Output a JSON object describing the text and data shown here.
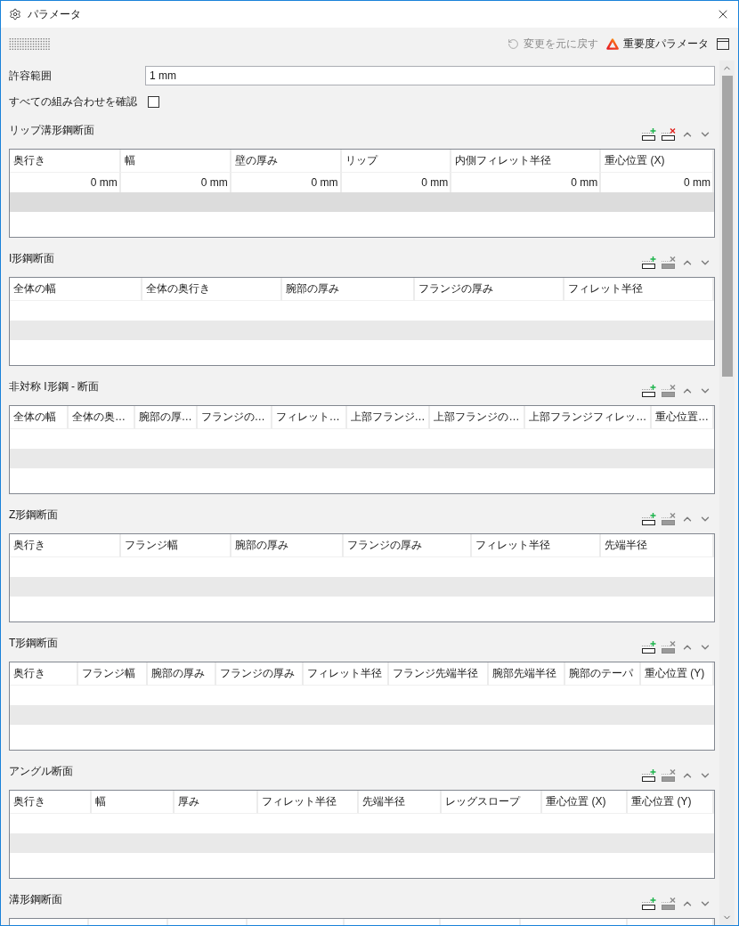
{
  "window": {
    "title": "パラメータ"
  },
  "toolbar": {
    "undo": {
      "label": "変更を元に戻す",
      "disabled": true
    },
    "importance": {
      "label": "重要度パラメータ"
    }
  },
  "tolerance": {
    "label": "許容範囲",
    "value": "1 mm"
  },
  "check_all": {
    "label": "すべての組み合わせを確認",
    "checked": false
  },
  "sections": [
    {
      "title": "リップ溝形鋼断面",
      "delete_disabled": false,
      "columns": [
        "奥行き",
        "幅",
        "壁の厚み",
        "リップ",
        "内側フィレット半径",
        "重心位置 (X)"
      ],
      "rows": [
        [
          "0 mm",
          "0 mm",
          "0 mm",
          "0 mm",
          "0 mm",
          "0 mm"
        ]
      ]
    },
    {
      "title": "I形鋼断面",
      "delete_disabled": true,
      "columns": [
        "全体の幅",
        "全体の奥行き",
        "腕部の厚み",
        "フランジの厚み",
        "フィレット半径"
      ]
    },
    {
      "title": "非対称 I形鋼 - 断面",
      "delete_disabled": true,
      "columns": [
        "全体の幅",
        "全体の奥…",
        "腕部の厚…",
        "フランジの…",
        "フィレット…",
        "上部フランジ…",
        "上部フランジの…",
        "上部フランジフィレッ…",
        "重心位置…"
      ]
    },
    {
      "title": "Z形鋼断面",
      "delete_disabled": true,
      "columns": [
        "奥行き",
        "フランジ幅",
        "腕部の厚み",
        "フランジの厚み",
        "フィレット半径",
        "先端半径"
      ]
    },
    {
      "title": "T形鋼断面",
      "delete_disabled": true,
      "columns": [
        "奥行き",
        "フランジ幅",
        "腕部の厚み",
        "フランジの厚み",
        "フィレット半径",
        "フランジ先端半径",
        "腕部先端半径",
        "腕部のテーパ",
        "重心位置 (Y)"
      ]
    },
    {
      "title": "アングル断面",
      "delete_disabled": true,
      "columns": [
        "奥行き",
        "幅",
        "厚み",
        "フィレット半径",
        "先端半径",
        "レッグスロープ",
        "重心位置 (X)",
        "重心位置 (Y)"
      ]
    },
    {
      "title": "溝形鋼断面",
      "delete_disabled": true
    }
  ]
}
